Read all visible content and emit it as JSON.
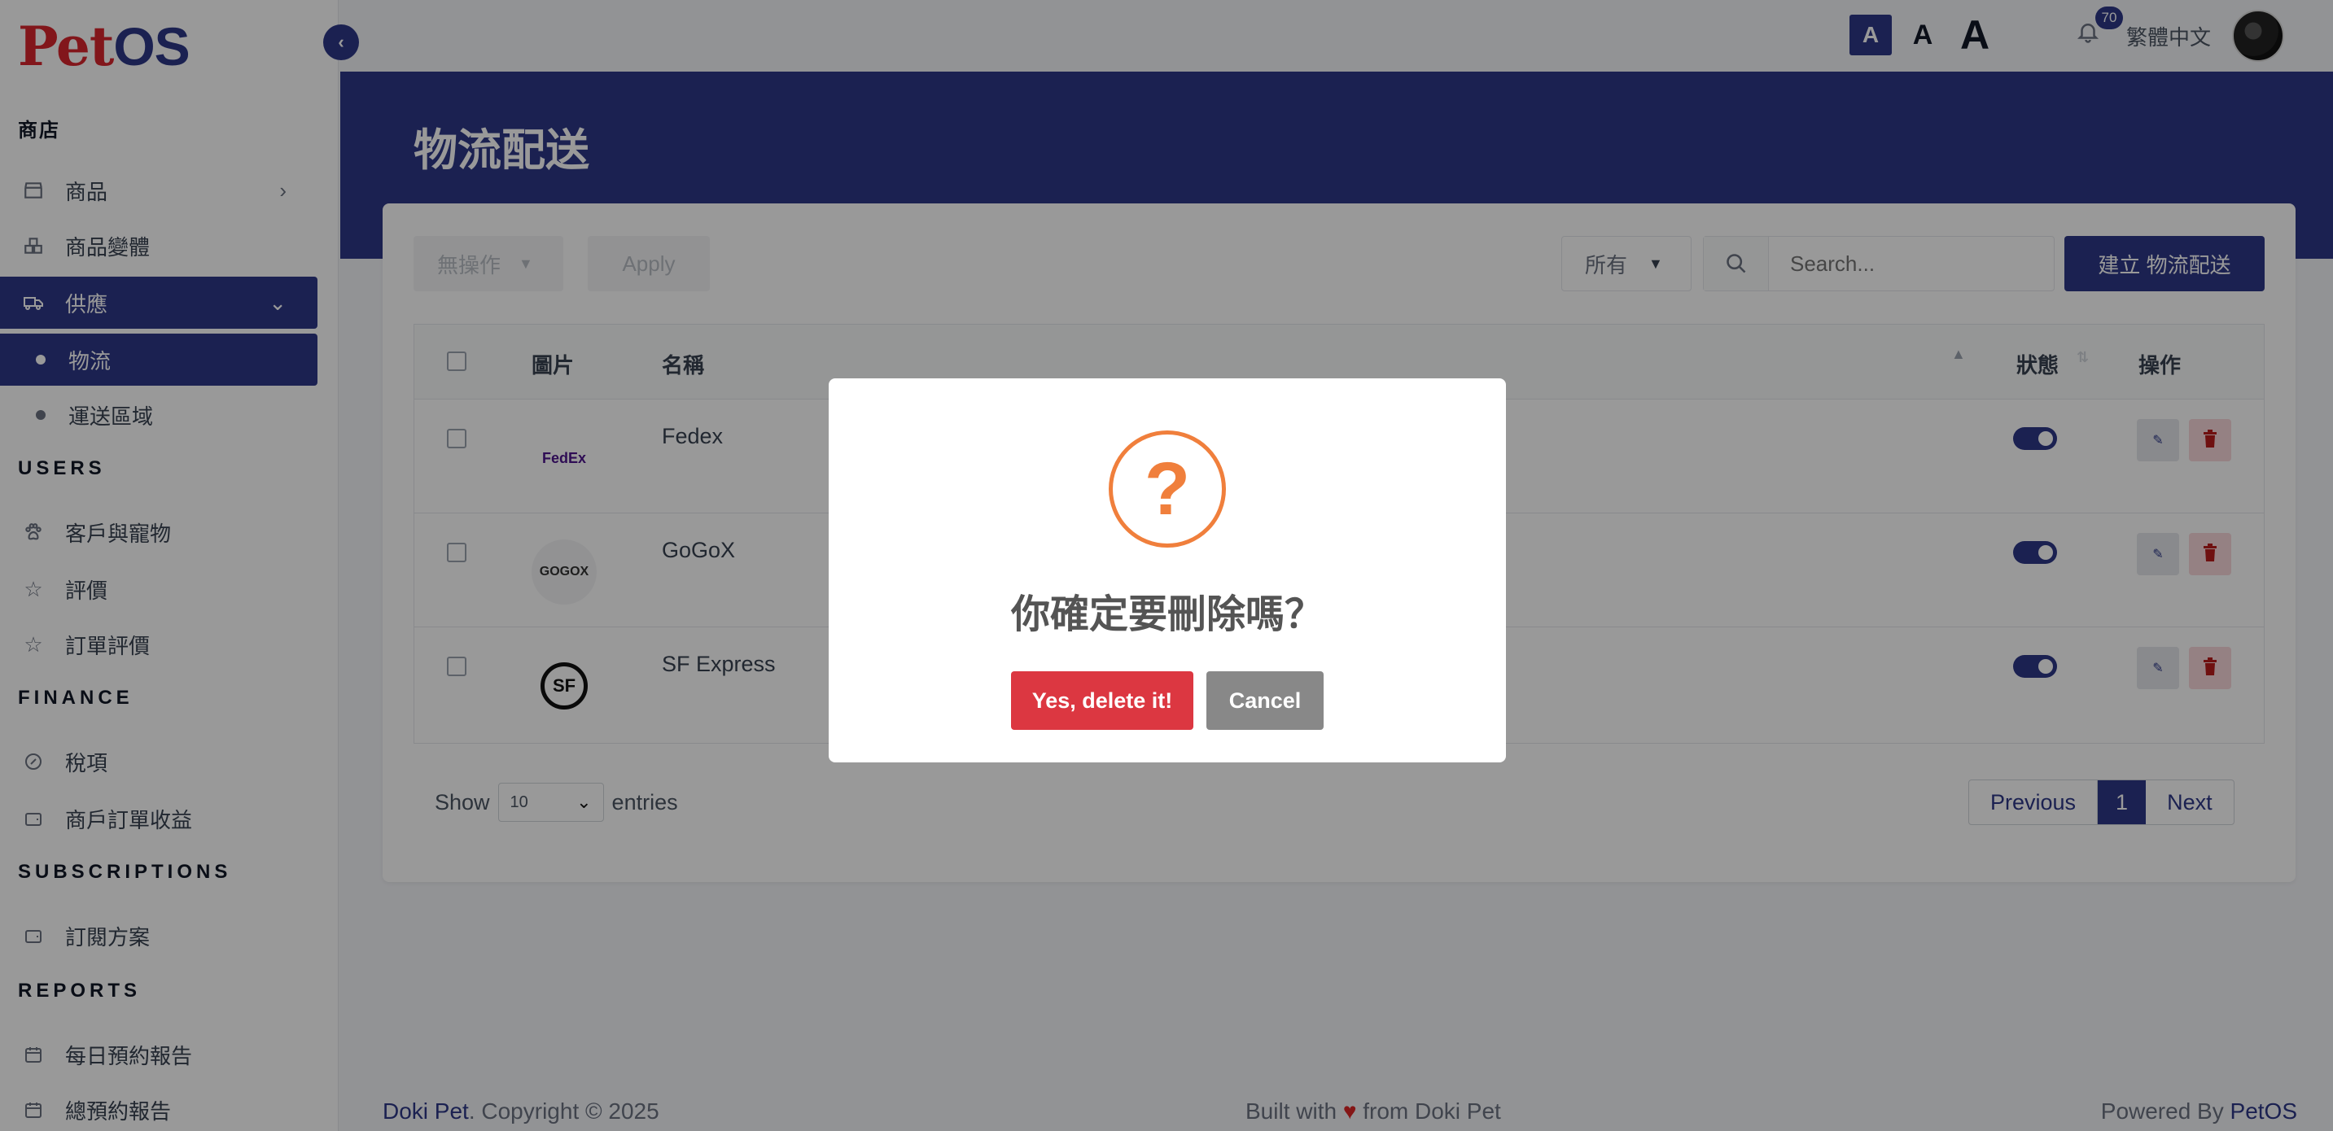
{
  "app": {
    "logo_pet": "Pet",
    "logo_os": "OS"
  },
  "sidebar": {
    "sections": {
      "store": "商店",
      "users": "USERS",
      "finance": "FINANCE",
      "subscriptions": "SUBSCRIPTIONS",
      "reports": "REPORTS"
    },
    "items": {
      "products": "商品",
      "variants": "商品變體",
      "supply": "供應",
      "logistics": "物流",
      "delivery_zones": "運送區域",
      "customers": "客戶與寵物",
      "reviews": "評價",
      "order_reviews": "訂單評價",
      "tax": "稅項",
      "merchant_income": "商戶訂單收益",
      "plans": "訂閱方案",
      "daily_report": "每日預約報告",
      "total_report": "總預約報告"
    }
  },
  "topbar": {
    "font_small": "A",
    "font_medium": "A",
    "font_large": "A",
    "notifications": "70",
    "language": "繁體中文"
  },
  "page": {
    "title": "物流配送"
  },
  "toolbar": {
    "bulk_action": "無操作",
    "apply": "Apply",
    "filter": "所有",
    "search_placeholder": "Search...",
    "create": "建立 物流配送"
  },
  "table": {
    "headers": {
      "image": "圖片",
      "name": "名稱",
      "status": "狀態",
      "actions": "操作"
    },
    "rows": [
      {
        "name": "Fedex",
        "logo_text": "FedEx",
        "status": true
      },
      {
        "name": "GoGoX",
        "logo_text": "GOGOX",
        "status": true
      },
      {
        "name": "SF Express",
        "logo_text": "SF",
        "status": true
      }
    ]
  },
  "pagination": {
    "show": "Show",
    "page_size": "10",
    "entries": "entries",
    "previous": "Previous",
    "current": "1",
    "next": "Next"
  },
  "footer": {
    "brand": "Doki Pet",
    "copyright": ". Copyright © 2025",
    "built_with": "Built with",
    "built_from": "from Doki Pet",
    "powered_by": "Powered By ",
    "powered_brand": "PetOS"
  },
  "modal": {
    "icon": "?",
    "title": "你確定要刪除嗎？",
    "confirm": "Yes, delete it!",
    "cancel": "Cancel"
  },
  "colors": {
    "primary": "#2e3888",
    "danger": "#dc3741",
    "warning_icon": "#f07f3c",
    "cancel": "#888888"
  }
}
